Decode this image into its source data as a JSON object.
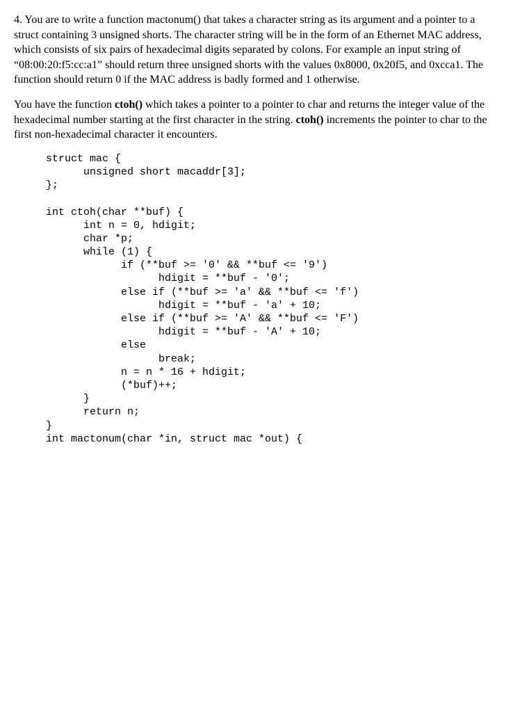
{
  "question": {
    "number": "4.",
    "para1": "You are to write a function mactonum() that takes a character string as its argument and a pointer to a struct containing 3 unsigned shorts.  The character string will be in the form of an Ethernet MAC address, which consists of six pairs of hexadecimal digits separated by colons.  For example an input string of “08:00:20:f5:cc:a1” should return three unsigned shorts with the values 0x8000, 0x20f5, and 0xcca1.  The function should return 0 if the MAC address is badly formed and 1 otherwise.",
    "para2_pre1": "You have the function ",
    "para2_bold1": "ctoh()",
    "para2_mid1": " which takes a pointer to a pointer to char and returns the integer value of the hexadecimal number starting at the first character in the string.  ",
    "para2_bold2": "ctoh()",
    "para2_post": " increments the pointer to char to the first non-hexadecimal character it encounters."
  },
  "code": "struct mac {\n      unsigned short macaddr[3];\n};\n\nint ctoh(char **buf) {\n      int n = 0, hdigit;\n      char *p;\n      while (1) {\n            if (**buf >= '0' && **buf <= '9')\n                  hdigit = **buf - '0';\n            else if (**buf >= 'a' && **buf <= 'f')\n                  hdigit = **buf - 'a' + 10;\n            else if (**buf >= 'A' && **buf <= 'F')\n                  hdigit = **buf - 'A' + 10;\n            else\n                  break;\n            n = n * 16 + hdigit;\n            (*buf)++;\n      }\n      return n;\n}\nint mactonum(char *in, struct mac *out) {"
}
